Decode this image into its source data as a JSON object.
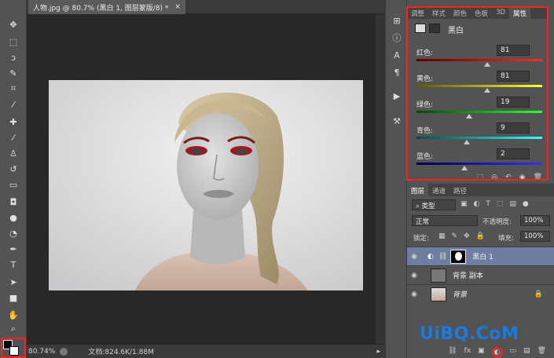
{
  "document": {
    "tab_title": "人物.jpg @ 80.7% (黑白 1, 图层蒙版/8) *",
    "close_glyph": "×"
  },
  "status": {
    "zoom": "80.74%",
    "doc_info": "文档:824.6K/1.88M"
  },
  "properties_panel": {
    "tabs": [
      "调整",
      "样式",
      "颜色",
      "色板",
      "3D",
      "属性"
    ],
    "active_tab": "属性",
    "adjustment_name": "黑白",
    "sliders": [
      {
        "label": "红色:",
        "value": "81",
        "colors": [
          "#5a0000",
          "#ff2a2a"
        ],
        "level": 0.56
      },
      {
        "label": "黄色:",
        "value": "81",
        "colors": [
          "#5a5a00",
          "#ffff30"
        ],
        "level": 0.56
      },
      {
        "label": "绿色:",
        "value": "19",
        "colors": [
          "#004a00",
          "#2cff2c"
        ],
        "level": 0.42
      },
      {
        "label": "青色:",
        "value": "9",
        "colors": [
          "#004a4a",
          "#30ffff"
        ],
        "level": 0.4
      },
      {
        "label": "蓝色:",
        "value": "2",
        "colors": [
          "#00004a",
          "#3030ff"
        ],
        "level": 0.38
      }
    ],
    "highlight_color": "#ff2020"
  },
  "layers_panel": {
    "tabs": [
      "图层",
      "通道",
      "路径"
    ],
    "active_tab": "图层",
    "filter_kind": "类型",
    "blend_mode": "正常",
    "opacity_label": "不透明度:",
    "opacity_value": "100%",
    "lock_label": "锁定:",
    "fill_label": "填充:",
    "fill_value": "100%",
    "layers": [
      {
        "name": "黑白 1",
        "selected": true
      },
      {
        "name": "背景 副本",
        "selected": false
      },
      {
        "name": "背景",
        "selected": false
      }
    ],
    "footer_icons": [
      "link-icon",
      "fx-icon",
      "mask-icon",
      "adjustment-icon",
      "folder-icon",
      "new-layer-icon",
      "trash-icon"
    ]
  },
  "watermark": "UiBQ.CoM",
  "accent_color": "#6d7ea0"
}
